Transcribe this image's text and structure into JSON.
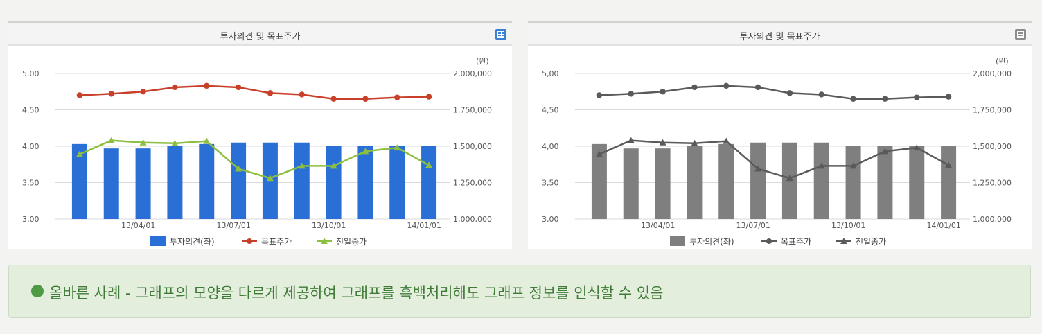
{
  "notice": {
    "text": "올바른 사례 - 그래프의 모양을 다르게 제공하여 그래프를 흑백처리해도 그래프 정보를 인식할 수 있음",
    "color": "#4f9a45"
  },
  "colors": {
    "color_bar": "#2a6fd6",
    "color_target": "#c9402a",
    "color_close": "#8cbf3f",
    "gray_bar": "#7f7f7f",
    "gray_line": "#5a5a5a",
    "icon_color": "#3b7fd4",
    "icon_gray": "#8c8c8c"
  },
  "chart_data": [
    {
      "type": "bar",
      "variant": "color",
      "title": "투자의견 및 목표주가",
      "icon": "table-icon",
      "unit_right": "(원)",
      "x_ticks": [
        "13/04/01",
        "13/07/01",
        "13/10/01",
        "14/01/01"
      ],
      "y_left": {
        "ticks": [
          "5,00",
          "4,50",
          "4,00",
          "3,50",
          "3,00"
        ],
        "lim": [
          3.0,
          5.0
        ]
      },
      "y_right": {
        "ticks": [
          "2,000,000",
          "1,750,000",
          "1,500,000",
          "1,250,000",
          "1,000,000"
        ],
        "lim": [
          1000000,
          2000000
        ]
      },
      "grid": true,
      "legend_position": "bottom",
      "series": [
        {
          "name": "투자의견(좌)",
          "kind": "bar",
          "axis": "left",
          "values": [
            4.03,
            3.97,
            3.97,
            4.0,
            4.03,
            4.05,
            4.05,
            4.05,
            4.0,
            4.0,
            4.0,
            4.0
          ]
        },
        {
          "name": "목표주가",
          "kind": "line",
          "marker": "circle",
          "axis": "right",
          "values": [
            1850000,
            1860000,
            1875000,
            1905000,
            1915000,
            1905000,
            1865000,
            1855000,
            1825000,
            1825000,
            1835000,
            1840000
          ]
        },
        {
          "name": "전일종가",
          "kind": "line",
          "marker": "triangle",
          "axis": "right",
          "values": [
            1445000,
            1540000,
            1525000,
            1520000,
            1535000,
            1345000,
            1280000,
            1365000,
            1365000,
            1465000,
            1490000,
            1370000
          ]
        }
      ]
    },
    {
      "type": "bar",
      "variant": "gray",
      "title": "투자의견 및 목표주가",
      "icon": "table-icon",
      "unit_right": "(원)",
      "x_ticks": [
        "13/04/01",
        "13/07/01",
        "13/10/01",
        "14/01/01"
      ],
      "y_left": {
        "ticks": [
          "5,00",
          "4,50",
          "4,00",
          "3,50",
          "3,00"
        ],
        "lim": [
          3.0,
          5.0
        ]
      },
      "y_right": {
        "ticks": [
          "2,000,000",
          "1,750,000",
          "1,500,000",
          "1,250,000",
          "1,000,000"
        ],
        "lim": [
          1000000,
          2000000
        ]
      },
      "grid": true,
      "legend_position": "bottom",
      "series": [
        {
          "name": "투자의견(좌)",
          "kind": "bar",
          "axis": "left",
          "values": [
            4.03,
            3.97,
            3.97,
            4.0,
            4.03,
            4.05,
            4.05,
            4.05,
            4.0,
            4.0,
            4.0,
            4.0
          ]
        },
        {
          "name": "목표주가",
          "kind": "line",
          "marker": "circle",
          "axis": "right",
          "values": [
            1850000,
            1860000,
            1875000,
            1905000,
            1915000,
            1905000,
            1865000,
            1855000,
            1825000,
            1825000,
            1835000,
            1840000
          ]
        },
        {
          "name": "전일종가",
          "kind": "line",
          "marker": "triangle",
          "axis": "right",
          "values": [
            1445000,
            1540000,
            1525000,
            1520000,
            1535000,
            1345000,
            1280000,
            1365000,
            1365000,
            1465000,
            1490000,
            1370000
          ]
        }
      ]
    }
  ]
}
